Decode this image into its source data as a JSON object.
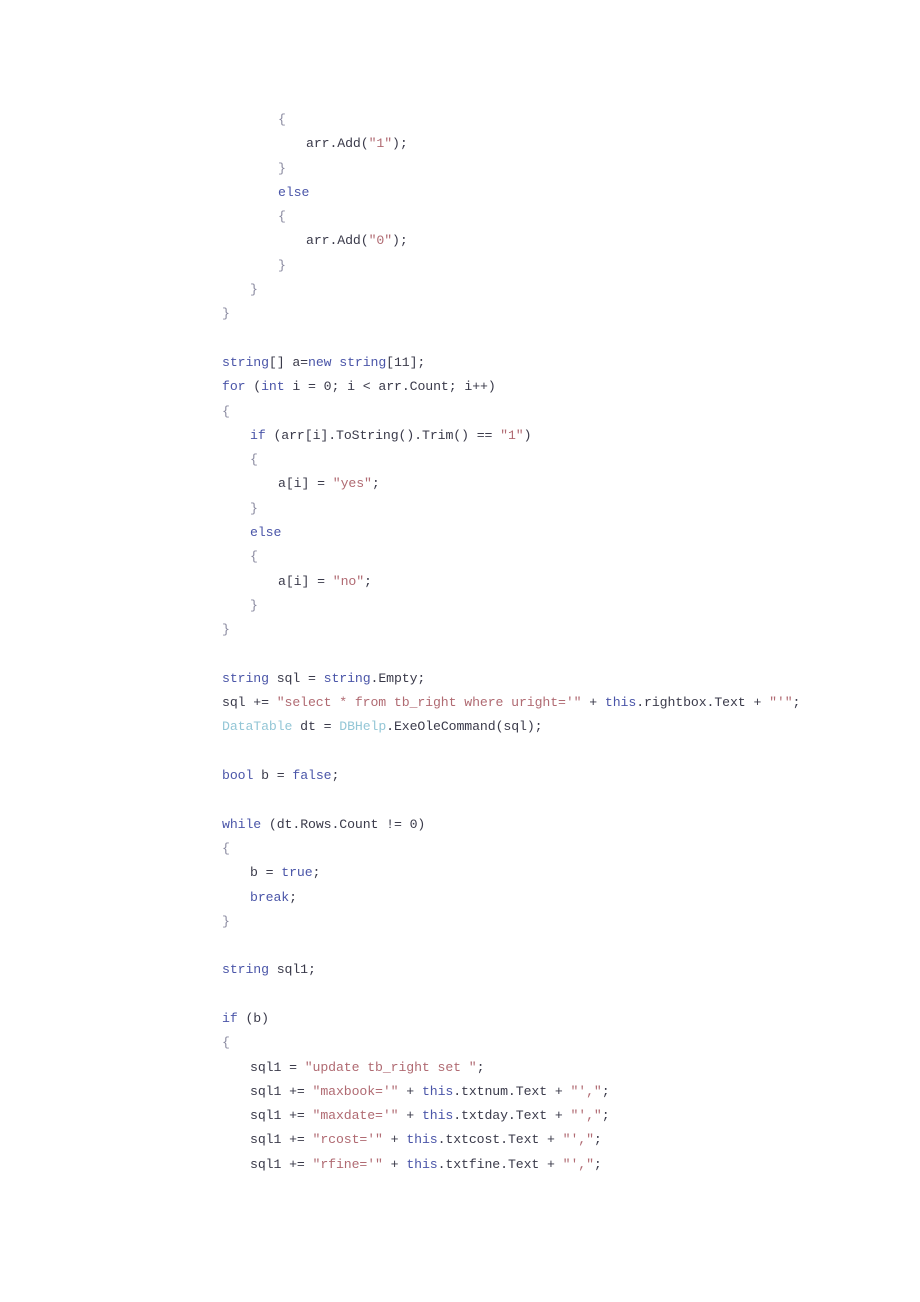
{
  "document": {
    "type": "code-listing",
    "language": "C#",
    "page_background": "#ffffff",
    "colors": {
      "keyword": "#4a55a8",
      "string": "#b06a72",
      "type": "#93c6d6",
      "plain": "#3a3a4a",
      "brace": "#8a8aa0"
    },
    "lines": [
      {
        "indent": 2,
        "text": "{"
      },
      {
        "indent": 3,
        "text": "arr.Add(\"1\");"
      },
      {
        "indent": 2,
        "text": "}"
      },
      {
        "indent": 2,
        "text": "else"
      },
      {
        "indent": 2,
        "text": "{"
      },
      {
        "indent": 3,
        "text": "arr.Add(\"0\");"
      },
      {
        "indent": 2,
        "text": "}"
      },
      {
        "indent": 1,
        "text": "}"
      },
      {
        "indent": 0,
        "text": "}"
      },
      {
        "indent": 0,
        "text": ""
      },
      {
        "indent": 0,
        "text": "string[] a=new string[11];"
      },
      {
        "indent": 0,
        "text": "for (int i = 0; i < arr.Count; i++)"
      },
      {
        "indent": 0,
        "text": "{"
      },
      {
        "indent": 1,
        "text": "if (arr[i].ToString().Trim() == \"1\")"
      },
      {
        "indent": 1,
        "text": "{"
      },
      {
        "indent": 2,
        "text": "a[i] = \"yes\";"
      },
      {
        "indent": 1,
        "text": "}"
      },
      {
        "indent": 1,
        "text": "else"
      },
      {
        "indent": 1,
        "text": "{"
      },
      {
        "indent": 2,
        "text": "a[i] = \"no\";"
      },
      {
        "indent": 1,
        "text": "}"
      },
      {
        "indent": 0,
        "text": "}"
      },
      {
        "indent": 0,
        "text": ""
      },
      {
        "indent": 0,
        "text": "string sql = string.Empty;"
      },
      {
        "indent": 0,
        "text": "sql += \"select * from tb_right where uright='\" + this.rightbox.Text + \"'\";"
      },
      {
        "indent": 0,
        "text": "DataTable dt = DBHelp.ExeOleCommand(sql);"
      },
      {
        "indent": 0,
        "text": ""
      },
      {
        "indent": 0,
        "text": "bool b = false;"
      },
      {
        "indent": 0,
        "text": ""
      },
      {
        "indent": 0,
        "text": "while (dt.Rows.Count != 0)"
      },
      {
        "indent": 0,
        "text": "{"
      },
      {
        "indent": 1,
        "text": "b = true;"
      },
      {
        "indent": 1,
        "text": "break;"
      },
      {
        "indent": 0,
        "text": "}"
      },
      {
        "indent": 0,
        "text": ""
      },
      {
        "indent": 0,
        "text": "string sql1;"
      },
      {
        "indent": 0,
        "text": ""
      },
      {
        "indent": 0,
        "text": "if (b)"
      },
      {
        "indent": 0,
        "text": "{"
      },
      {
        "indent": 1,
        "text": "sql1 = \"update tb_right set \";"
      },
      {
        "indent": 1,
        "text": "sql1 += \"maxbook='\" + this.txtnum.Text + \"',\";"
      },
      {
        "indent": 1,
        "text": "sql1 += \"maxdate='\" + this.txtday.Text + \"',\";"
      },
      {
        "indent": 1,
        "text": "sql1 += \"rcost='\" + this.txtcost.Text + \"',\";"
      },
      {
        "indent": 1,
        "text": "sql1 += \"rfine='\" + this.txtfine.Text + \"',\";"
      }
    ]
  }
}
